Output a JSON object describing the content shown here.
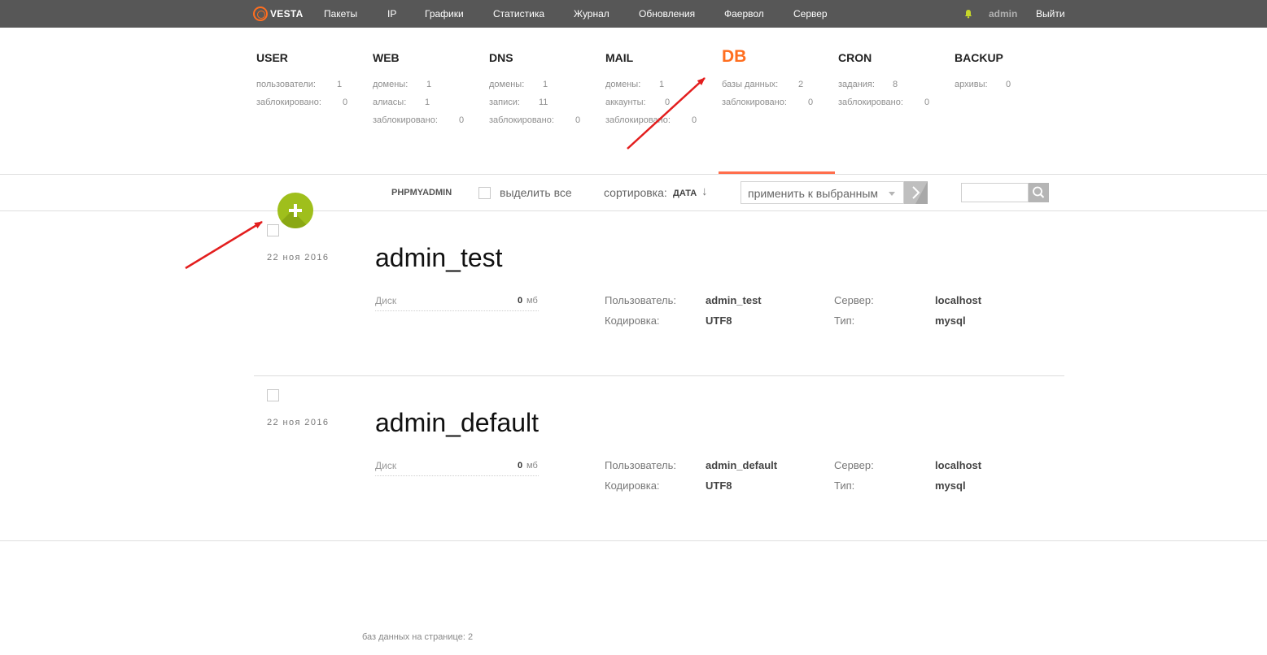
{
  "topbar": {
    "logo_text": "VESTA",
    "nav": [
      "Пакеты",
      "IP",
      "Графики",
      "Статистика",
      "Журнал",
      "Обновления",
      "Фаервол",
      "Сервер"
    ],
    "user": "admin",
    "logout": "Выйти"
  },
  "tabs": [
    {
      "title": "USER",
      "stats": [
        {
          "label": "пользователи:",
          "value": "1"
        },
        {
          "label": "заблокировано:",
          "value": "0"
        }
      ]
    },
    {
      "title": "WEB",
      "stats": [
        {
          "label": "домены:",
          "value": "1"
        },
        {
          "label": "алиасы:",
          "value": "1"
        },
        {
          "label": "заблокировано:",
          "value": "0"
        }
      ]
    },
    {
      "title": "DNS",
      "stats": [
        {
          "label": "домены:",
          "value": "1"
        },
        {
          "label": "записи:",
          "value": "11"
        },
        {
          "label": "заблокировано:",
          "value": "0"
        }
      ]
    },
    {
      "title": "MAIL",
      "stats": [
        {
          "label": "домены:",
          "value": "1"
        },
        {
          "label": "аккаунты:",
          "value": "0"
        },
        {
          "label": "заблокировано:",
          "value": "0"
        }
      ]
    },
    {
      "title": "DB",
      "active": true,
      "stats": [
        {
          "label": "базы данных:",
          "value": "2"
        },
        {
          "label": "заблокировано:",
          "value": "0"
        }
      ]
    },
    {
      "title": "CRON",
      "stats": [
        {
          "label": "задания:",
          "value": "8"
        },
        {
          "label": "заблокировано:",
          "value": "0"
        }
      ]
    },
    {
      "title": "BACKUP",
      "stats": [
        {
          "label": "архивы:",
          "value": "0"
        }
      ]
    }
  ],
  "toolbar": {
    "phpmyadmin": "PHPMYADMIN",
    "select_all": "выделить все",
    "sort_label": "сортировка:",
    "sort_value": "ДАТА",
    "sort_arrow": "↓",
    "apply_select": "применить к выбранным"
  },
  "databases": [
    {
      "date": "22 ноя 2016",
      "name": "admin_test",
      "disk_label": "Диск",
      "disk_value": "0",
      "disk_unit": "мб",
      "user_label": "Пользователь:",
      "user": "admin_test",
      "charset_label": "Кодировка:",
      "charset": "UTF8",
      "server_label": "Сервер:",
      "server": "localhost",
      "type_label": "Тип:",
      "type": "mysql"
    },
    {
      "date": "22 ноя 2016",
      "name": "admin_default",
      "disk_label": "Диск",
      "disk_value": "0",
      "disk_unit": "мб",
      "user_label": "Пользователь:",
      "user": "admin_default",
      "charset_label": "Кодировка:",
      "charset": "UTF8",
      "server_label": "Сервер:",
      "server": "localhost",
      "type_label": "Тип:",
      "type": "mysql"
    }
  ],
  "footer": "баз данных на странице: 2",
  "colors": {
    "topbar_bg": "#575757",
    "accent": "#ff6e1f",
    "add_button": "#9fbf1c",
    "annotation_arrow": "#e31e1e"
  }
}
